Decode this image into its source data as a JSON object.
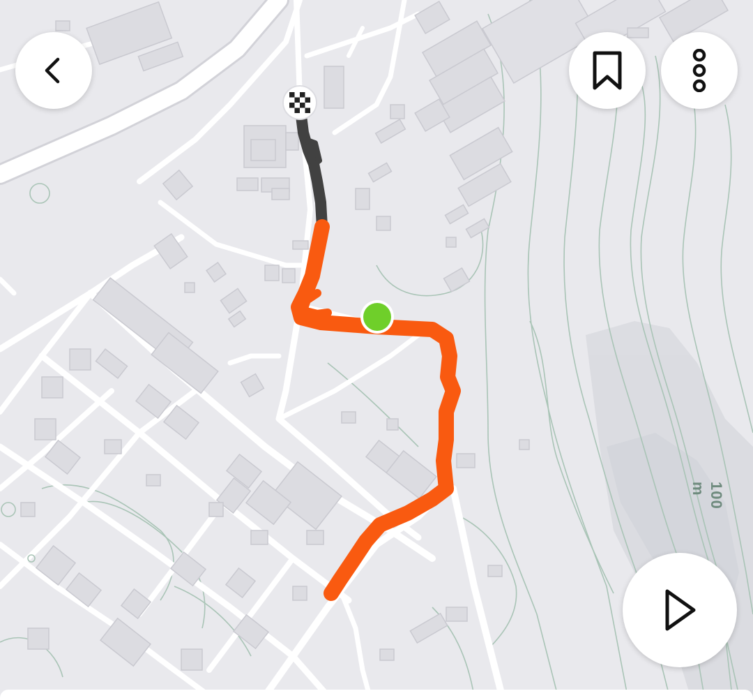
{
  "map": {
    "colors": {
      "background": "#e9e9ed",
      "road": "#ffffff",
      "building": "#dcdce1",
      "building_stroke": "#cfcfd6",
      "contour": "#a9c4b6",
      "hill_shade": "#d6d8dd",
      "route_completed": "#f95a10",
      "route_remaining": "#414141",
      "start_marker": "#6fcf2a"
    },
    "contour_label": "100 m",
    "markers": {
      "start": "start-marker",
      "finish": "finish-flag-icon"
    }
  },
  "controls": {
    "back": "chevron-left-icon",
    "save": "bookmark-icon",
    "more": "more-vertical-icon",
    "play": "play-icon"
  }
}
